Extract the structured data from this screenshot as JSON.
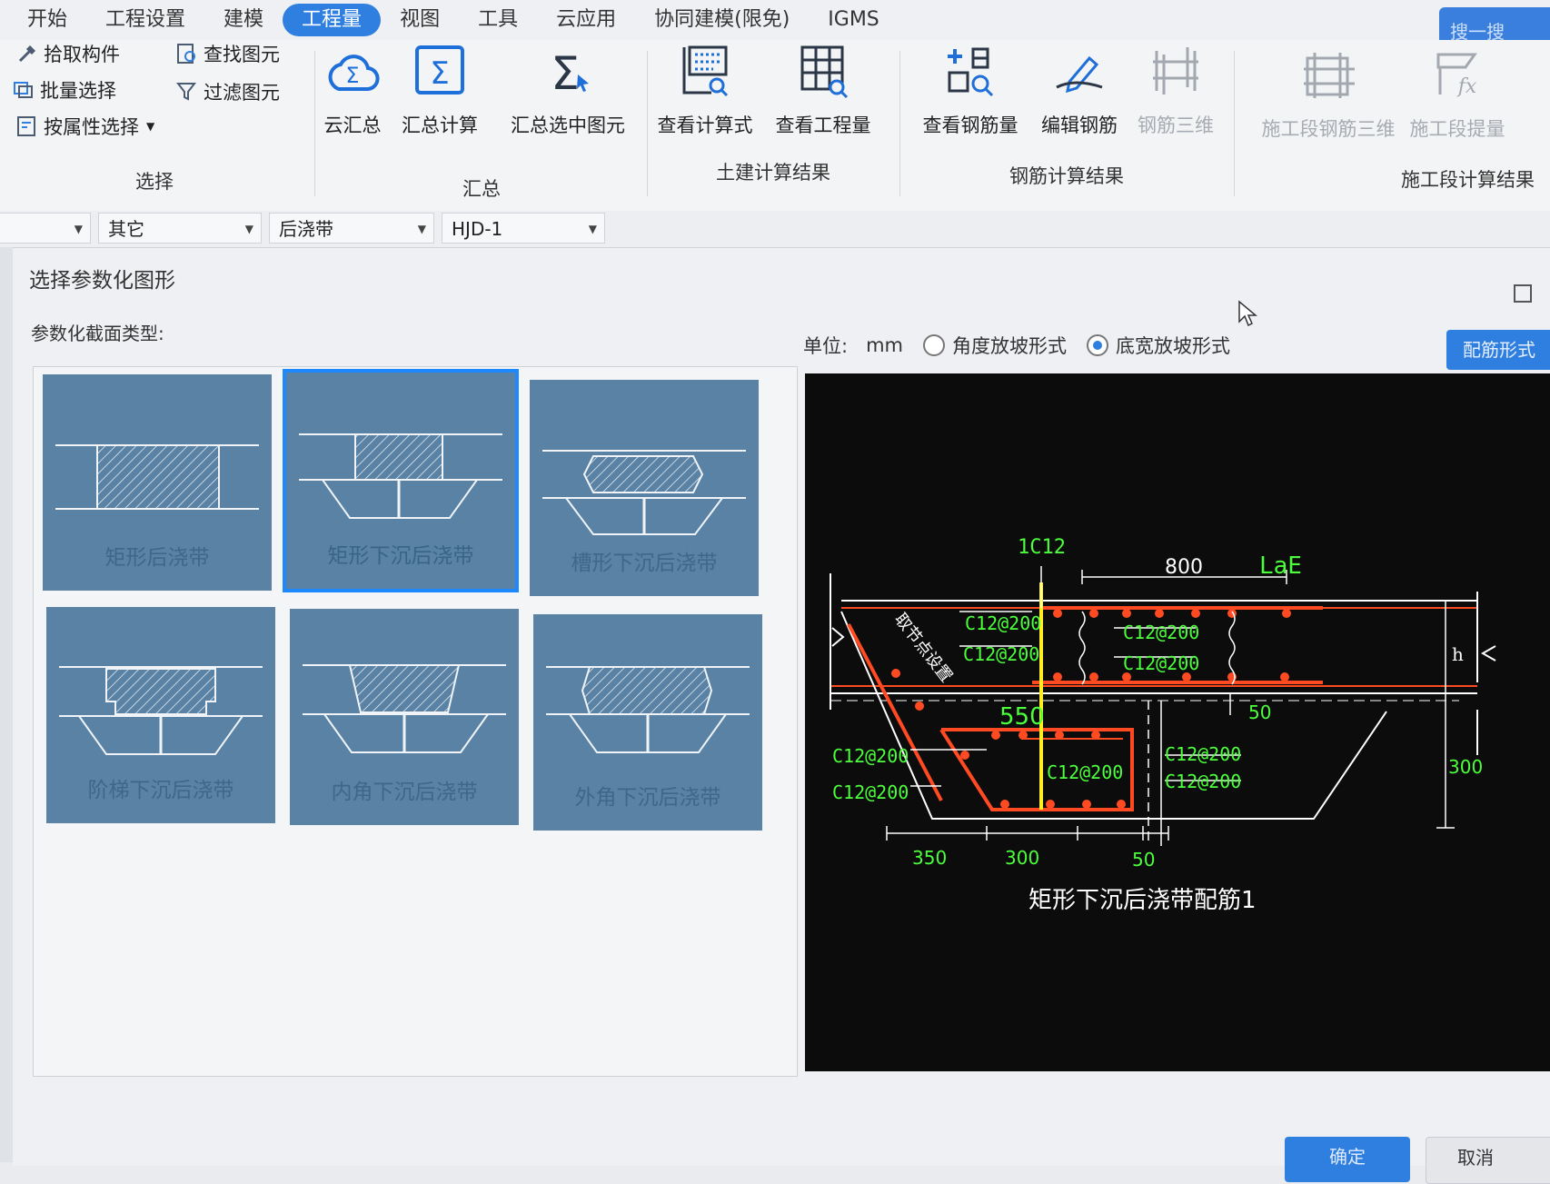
{
  "menu": {
    "items": [
      "开始",
      "工程设置",
      "建模",
      "工程量",
      "视图",
      "工具",
      "云应用",
      "协同建模(限免)",
      "IGMS"
    ],
    "active_index": 3,
    "search_label": "搜一搜"
  },
  "ribbon": {
    "select": {
      "title": "选择",
      "pick": "拾取构件",
      "batch": "批量选择",
      "by_attr": "按属性选择",
      "find": "查找图元",
      "filter": "过滤图元"
    },
    "summary": {
      "title": "汇总",
      "cloud": "云汇总",
      "calc": "汇总计算",
      "calc_selected": "汇总选中图元"
    },
    "civil": {
      "title": "土建计算结果",
      "view_formula": "查看计算式",
      "view_quantity": "查看工程量"
    },
    "rebar": {
      "title": "钢筋计算结果",
      "view_rebar": "查看钢筋量",
      "edit_rebar": "编辑钢筋",
      "rebar_3d": "钢筋三维"
    },
    "stage": {
      "title": "施工段计算结果",
      "stage_rebar_3d": "施工段钢筋三维",
      "stage_extract": "施工段提量"
    }
  },
  "propbar": {
    "combo1": "",
    "combo2": "其它",
    "combo3": "后浇带",
    "combo4": "HJD-1"
  },
  "dialog": {
    "title": "选择参数化图形",
    "section_label": "参数化截面类型:",
    "unit_label": "单位:",
    "unit_value": "mm",
    "radio_angle": "角度放坡形式",
    "radio_width": "底宽放坡形式",
    "radio_selected": "底宽放坡形式",
    "style_button": "配筋形式",
    "ok": "确定",
    "cancel": "取消",
    "shapes": [
      "矩形后浇带",
      "矩形下沉后浇带",
      "槽形下沉后浇带",
      "阶梯下沉后浇带",
      "内角下沉后浇带",
      "外角下沉后浇带"
    ],
    "selected_shape": "矩形下沉后浇带"
  },
  "preview": {
    "caption": "矩形下沉后浇带配筋1",
    "bar_1c12": "1C12",
    "dim_800": "800",
    "lae": "LaE",
    "note_node": "取节点设置",
    "dim_550": "550",
    "h": "h",
    "dim_50_right": "50",
    "dim_300_right": "300",
    "dim_350": "350",
    "dim_300": "300",
    "dim_50": "50",
    "rebar_top_l1": "C12@200",
    "rebar_top_l2": "C12@200",
    "rebar_top_r1": "C12@200",
    "rebar_top_r2": "C12@200",
    "rebar_left_1": "C12@200",
    "rebar_left_2": "C12@200",
    "rebar_mid": "C12@200",
    "rebar_right_1": "C12@200",
    "rebar_right_2": "C12@200"
  }
}
